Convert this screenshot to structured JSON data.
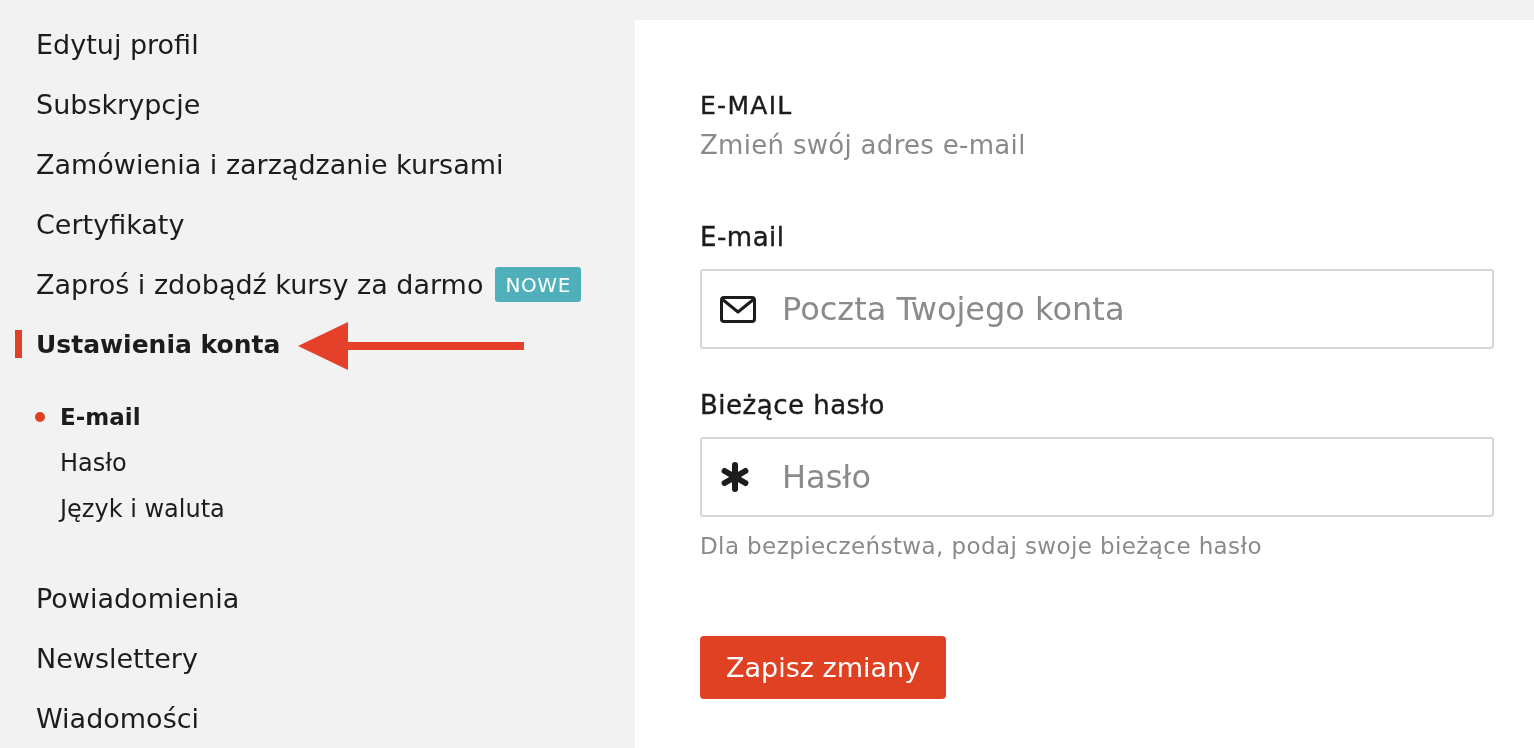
{
  "sidebar": {
    "items": [
      {
        "label": "Edytuj profil",
        "selected": false
      },
      {
        "label": "Subskrypcje",
        "selected": false
      },
      {
        "label": "Zamówienia i zarządzanie kursami",
        "selected": false
      },
      {
        "label": "Certyfikaty",
        "selected": false
      },
      {
        "label": "Zaproś i zdobądź kursy za darmo",
        "selected": false,
        "badge": "NOWE"
      },
      {
        "label": "Ustawienia konta",
        "selected": true,
        "children": [
          {
            "label": "E-mail",
            "selected": true
          },
          {
            "label": "Hasło",
            "selected": false
          },
          {
            "label": "Język i waluta",
            "selected": false
          }
        ]
      },
      {
        "label": "Powiadomienia",
        "selected": false
      },
      {
        "label": "Newslettery",
        "selected": false
      },
      {
        "label": "Wiadomości",
        "selected": false
      }
    ]
  },
  "section": {
    "title": "E-MAIL",
    "subtitle": "Zmień swój adres e-mail"
  },
  "fields": [
    {
      "label": "E-mail",
      "kind": "email",
      "placeholder": "Poczta Twojego konta"
    },
    {
      "label": "Bieżące hasło",
      "kind": "password",
      "placeholder": "Hasło",
      "hint": "Dla bezpieczeństwa, podaj swoje bieżące hasło"
    }
  ],
  "save_button": "Zapisz zmiany"
}
